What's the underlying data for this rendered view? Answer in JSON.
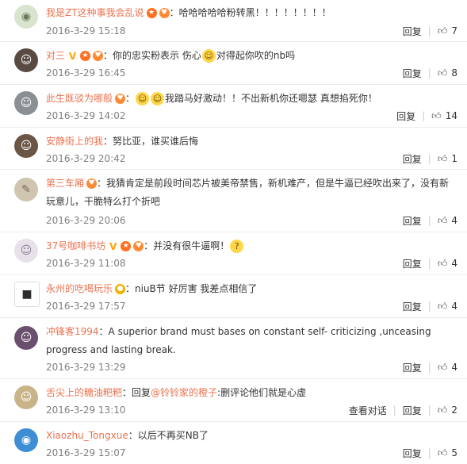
{
  "reply_label": "回复",
  "view_conversation_label": "查看对话",
  "comments": [
    {
      "username": "我是ZT这种事我会乱说",
      "badges": [
        "vip",
        "fan"
      ],
      "text": "：哈哈哈哈哈粉转黑！！！！！！！！",
      "time": "2016-3-29 15:18",
      "likes": "7",
      "avatar_color": "#d9e3ce",
      "avatar_icon": "cat-avatar-icon"
    },
    {
      "username": "对三",
      "badges": [
        "v",
        "vip",
        "fan"
      ],
      "text_before": "：你的忠实粉表示  伤心",
      "text_after": "对得起你吹的nb吗",
      "time": "2016-3-29 16:45",
      "likes": "8",
      "avatar_color": "#5a4a44",
      "avatar_icon": "person-avatar-icon"
    },
    {
      "username": "此生既驳为哪般",
      "badges": [
        "fan"
      ],
      "text_before": "：",
      "text_after": "我踏马好激动！！不出新机你还嗯瑟 真想掐死你！",
      "time": "2016-3-29 14:02",
      "likes": "14",
      "avatar_color": "#8a8f93",
      "avatar_icon": "person-avatar-icon"
    },
    {
      "username": "安静街上的我",
      "badges": [],
      "text": "：努比亚，谁买谁后悔",
      "time": "2016-3-29 20:42",
      "likes": "1",
      "avatar_color": "#6b5645",
      "avatar_icon": "person-avatar-icon"
    },
    {
      "username": "第三车厢",
      "badges": [
        "fan"
      ],
      "text": "：我猜肯定是前段时间芯片被美帝禁售，新机难产，但是牛逼已经吹出来了，没有新玩意儿，干脆特么打个折吧",
      "time": "2016-3-29 20:06",
      "likes": "4",
      "avatar_color": "#cfc5b0",
      "avatar_icon": "drawing-avatar-icon"
    },
    {
      "username": "37号咖啡书坊",
      "badges": [
        "v",
        "vip",
        "fan"
      ],
      "text": "：并没有很牛逼啊！",
      "time": "2016-3-29 11:08",
      "likes": "4",
      "avatar_color": "#e7e2ea",
      "avatar_icon": "person-avatar-icon"
    },
    {
      "username": "永州的吃喝玩乐",
      "badges": [
        "gold"
      ],
      "text": "：niuB节  好厉害  我差点相信了",
      "time": "2016-3-29 17:57",
      "likes": "4",
      "avatar_color": "#2e2e2e",
      "avatar_icon": "logo-avatar-icon"
    },
    {
      "username": "冲锋客1994",
      "badges": [],
      "text": "：A superior brand must bases on constant self-    criticizing ,unceasing progress and lasting break.",
      "time": "2016-3-29 13:29",
      "likes": "4",
      "avatar_color": "#6b4f6e",
      "avatar_icon": "person-avatar-icon"
    },
    {
      "username": "舌尖上的糖油粑粑",
      "badges": [],
      "text_before": "：回复",
      "mention": "@铃铃家的橙子",
      "text_after": ":删评论他们就是心虚",
      "time": "2016-3-29 13:10",
      "likes": "2",
      "avatar_color": "#c9b48a",
      "avatar_icon": "person-avatar-icon"
    },
    {
      "username": "Xiaozhu_Tongxue",
      "badges": [],
      "text": "：以后不再买NB了",
      "time": "2016-3-29 15:07",
      "likes": "5",
      "avatar_color": "#3e8ed6",
      "avatar_icon": "doraemon-avatar-icon"
    }
  ]
}
